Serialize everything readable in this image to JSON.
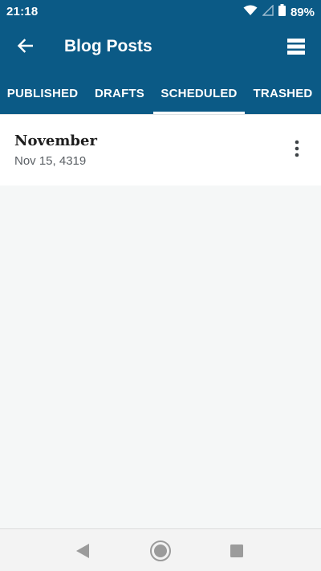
{
  "status_bar": {
    "time": "21:18",
    "battery_percent": "89%",
    "icons": [
      "wifi-icon",
      "cell-signal-icon",
      "battery-icon"
    ]
  },
  "app_bar": {
    "title": "Blog Posts",
    "back_icon": "arrow-left-icon",
    "menu_icon": "list-view-icon"
  },
  "tabs": [
    {
      "label": "PUBLISHED",
      "selected": false
    },
    {
      "label": "DRAFTS",
      "selected": false
    },
    {
      "label": "SCHEDULED",
      "selected": true
    },
    {
      "label": "TRASHED",
      "selected": false
    }
  ],
  "posts": [
    {
      "title": "November",
      "date": "Nov 15, 4319",
      "more_icon": "more-vertical-icon"
    }
  ],
  "nav_bar": {
    "icons": [
      "nav-back-icon",
      "nav-home-icon",
      "nav-recents-icon"
    ]
  },
  "colors": {
    "primary": "#0b5a86",
    "background": "#f5f7f7",
    "card": "#ffffff",
    "title_text": "#1e1e1e",
    "secondary_text": "#5b6065"
  }
}
